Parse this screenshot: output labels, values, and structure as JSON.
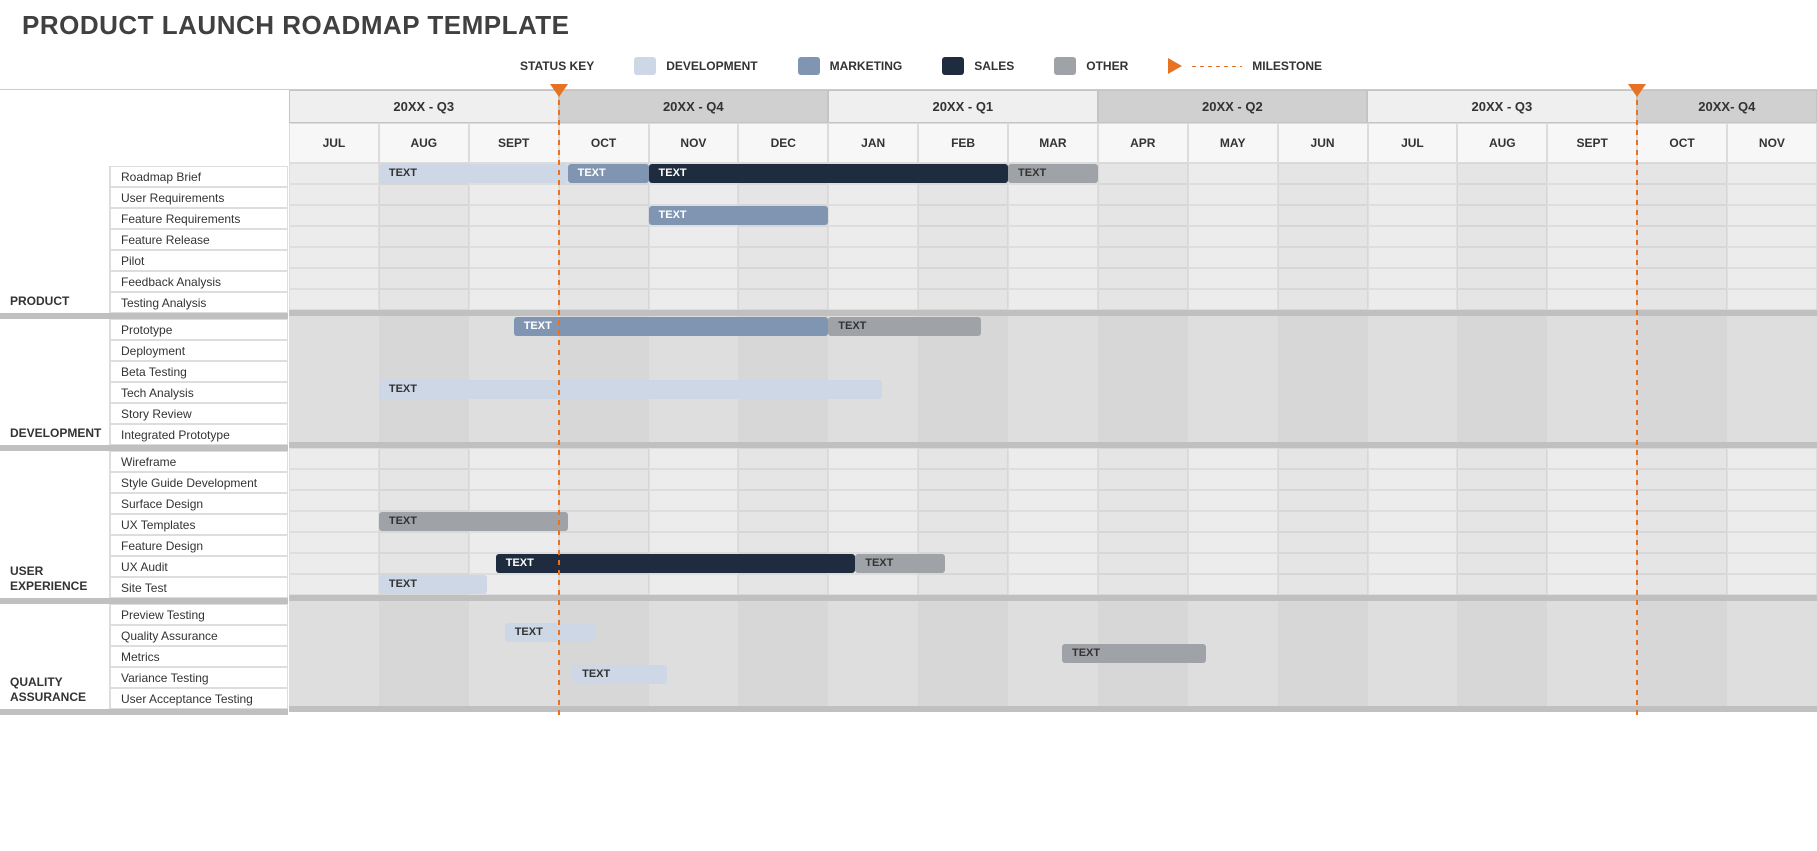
{
  "title": "PRODUCT LAUNCH ROADMAP TEMPLATE",
  "legend": {
    "key_label": "STATUS KEY",
    "development": "DEVELOPMENT",
    "marketing": "MARKETING",
    "sales": "SALES",
    "other": "OTHER",
    "milestone": "MILESTONE"
  },
  "quarters": [
    "20XX - Q3",
    "20XX - Q4",
    "20XX - Q1",
    "20XX - Q2",
    "20XX - Q3",
    "20XX- Q4"
  ],
  "months": [
    "JUL",
    "AUG",
    "SEPT",
    "OCT",
    "NOV",
    "DEC",
    "JAN",
    "FEB",
    "MAR",
    "APR",
    "MAY",
    "JUN",
    "JUL",
    "AUG",
    "SEPT",
    "OCT",
    "NOV"
  ],
  "month_count": 17,
  "milestones": [
    3,
    15
  ],
  "sections": [
    {
      "name": "PRODUCT",
      "tasks": [
        {
          "label": "Roadmap Brief",
          "bars": [
            {
              "type": "dev",
              "start": 1,
              "end": 3.1,
              "text": "TEXT"
            },
            {
              "type": "mkt",
              "start": 3.1,
              "end": 4,
              "text": "TEXT"
            },
            {
              "type": "sales",
              "start": 4,
              "end": 8,
              "text": "TEXT"
            },
            {
              "type": "other",
              "start": 8,
              "end": 9,
              "text": "TEXT"
            }
          ]
        },
        {
          "label": "User Requirements",
          "bars": []
        },
        {
          "label": "Feature Requirements",
          "bars": [
            {
              "type": "mkt",
              "start": 4,
              "end": 6,
              "text": "TEXT"
            }
          ]
        },
        {
          "label": "Feature Release",
          "bars": []
        },
        {
          "label": "Pilot",
          "bars": []
        },
        {
          "label": "Feedback Analysis",
          "bars": []
        },
        {
          "label": "Testing Analysis",
          "bars": []
        }
      ]
    },
    {
      "name": "DEVELOPMENT",
      "tasks": [
        {
          "label": "Prototype",
          "bars": [
            {
              "type": "mkt",
              "start": 2.5,
              "end": 6,
              "text": "TEXT"
            },
            {
              "type": "other",
              "start": 6,
              "end": 7.7,
              "text": "TEXT"
            }
          ]
        },
        {
          "label": "Deployment",
          "bars": []
        },
        {
          "label": "Beta Testing",
          "bars": []
        },
        {
          "label": "Tech Analysis",
          "bars": [
            {
              "type": "dev",
              "start": 1,
              "end": 6.6,
              "text": "TEXT"
            }
          ]
        },
        {
          "label": "Story Review",
          "bars": []
        },
        {
          "label": "Integrated Prototype",
          "bars": []
        }
      ]
    },
    {
      "name": "USER EXPERIENCE",
      "tasks": [
        {
          "label": "Wireframe",
          "bars": []
        },
        {
          "label": "Style Guide Development",
          "bars": []
        },
        {
          "label": "Surface Design",
          "bars": []
        },
        {
          "label": "UX Templates",
          "bars": [
            {
              "type": "other",
              "start": 1,
              "end": 3.1,
              "text": "TEXT"
            }
          ]
        },
        {
          "label": "Feature Design",
          "bars": []
        },
        {
          "label": "UX Audit",
          "bars": [
            {
              "type": "sales",
              "start": 2.3,
              "end": 6.3,
              "text": "TEXT"
            },
            {
              "type": "other",
              "start": 6.3,
              "end": 7.3,
              "text": "TEXT"
            }
          ]
        },
        {
          "label": "Site Test",
          "bars": [
            {
              "type": "dev",
              "start": 1,
              "end": 2.2,
              "text": "TEXT"
            }
          ]
        }
      ]
    },
    {
      "name": "QUALITY ASSURANCE",
      "tasks": [
        {
          "label": "Preview Testing",
          "bars": []
        },
        {
          "label": "Quality Assurance",
          "bars": [
            {
              "type": "dev",
              "start": 2.4,
              "end": 3.4,
              "text": "TEXT"
            }
          ]
        },
        {
          "label": "Metrics",
          "bars": [
            {
              "type": "other",
              "start": 8.6,
              "end": 10.2,
              "text": "TEXT"
            }
          ]
        },
        {
          "label": "Variance Testing",
          "bars": [
            {
              "type": "dev",
              "start": 3.15,
              "end": 4.2,
              "text": "TEXT"
            }
          ]
        },
        {
          "label": "User Acceptance Testing",
          "bars": []
        }
      ]
    }
  ],
  "chart_data": {
    "type": "gantt",
    "title": "PRODUCT LAUNCH ROADMAP TEMPLATE",
    "x_unit": "month_index (0 = JUL year1)",
    "x_labels": [
      "JUL",
      "AUG",
      "SEPT",
      "OCT",
      "NOV",
      "DEC",
      "JAN",
      "FEB",
      "MAR",
      "APR",
      "MAY",
      "JUN",
      "JUL",
      "AUG",
      "SEPT",
      "OCT",
      "NOV"
    ],
    "x_quarters": [
      "20XX-Q3",
      "20XX-Q4",
      "20XX-Q1",
      "20XX-Q2",
      "20XX-Q3",
      "20XX-Q4"
    ],
    "categories": [
      "DEVELOPMENT",
      "MARKETING",
      "SALES",
      "OTHER"
    ],
    "milestones_at": [
      3,
      15
    ],
    "rows": [
      {
        "section": "PRODUCT",
        "task": "Roadmap Brief",
        "segments": [
          {
            "cat": "DEVELOPMENT",
            "start": 1,
            "end": 3.1,
            "label": "TEXT"
          },
          {
            "cat": "MARKETING",
            "start": 3.1,
            "end": 4,
            "label": "TEXT"
          },
          {
            "cat": "SALES",
            "start": 4,
            "end": 8,
            "label": "TEXT"
          },
          {
            "cat": "OTHER",
            "start": 8,
            "end": 9,
            "label": "TEXT"
          }
        ]
      },
      {
        "section": "PRODUCT",
        "task": "User Requirements",
        "segments": []
      },
      {
        "section": "PRODUCT",
        "task": "Feature Requirements",
        "segments": [
          {
            "cat": "MARKETING",
            "start": 4,
            "end": 6,
            "label": "TEXT"
          }
        ]
      },
      {
        "section": "PRODUCT",
        "task": "Feature Release",
        "segments": []
      },
      {
        "section": "PRODUCT",
        "task": "Pilot",
        "segments": []
      },
      {
        "section": "PRODUCT",
        "task": "Feedback Analysis",
        "segments": []
      },
      {
        "section": "PRODUCT",
        "task": "Testing Analysis",
        "segments": []
      },
      {
        "section": "DEVELOPMENT",
        "task": "Prototype",
        "segments": [
          {
            "cat": "MARKETING",
            "start": 2.5,
            "end": 6,
            "label": "TEXT"
          },
          {
            "cat": "OTHER",
            "start": 6,
            "end": 7.7,
            "label": "TEXT"
          }
        ]
      },
      {
        "section": "DEVELOPMENT",
        "task": "Deployment",
        "segments": []
      },
      {
        "section": "DEVELOPMENT",
        "task": "Beta Testing",
        "segments": []
      },
      {
        "section": "DEVELOPMENT",
        "task": "Tech Analysis",
        "segments": [
          {
            "cat": "DEVELOPMENT",
            "start": 1,
            "end": 6.6,
            "label": "TEXT"
          }
        ]
      },
      {
        "section": "DEVELOPMENT",
        "task": "Story Review",
        "segments": []
      },
      {
        "section": "DEVELOPMENT",
        "task": "Integrated Prototype",
        "segments": []
      },
      {
        "section": "USER EXPERIENCE",
        "task": "Wireframe",
        "segments": []
      },
      {
        "section": "USER EXPERIENCE",
        "task": "Style Guide Development",
        "segments": []
      },
      {
        "section": "USER EXPERIENCE",
        "task": "Surface Design",
        "segments": []
      },
      {
        "section": "USER EXPERIENCE",
        "task": "UX Templates",
        "segments": [
          {
            "cat": "OTHER",
            "start": 1,
            "end": 3.1,
            "label": "TEXT"
          }
        ]
      },
      {
        "section": "USER EXPERIENCE",
        "task": "Feature Design",
        "segments": []
      },
      {
        "section": "USER EXPERIENCE",
        "task": "UX Audit",
        "segments": [
          {
            "cat": "SALES",
            "start": 2.3,
            "end": 6.3,
            "label": "TEXT"
          },
          {
            "cat": "OTHER",
            "start": 6.3,
            "end": 7.3,
            "label": "TEXT"
          }
        ]
      },
      {
        "section": "USER EXPERIENCE",
        "task": "Site Test",
        "segments": [
          {
            "cat": "DEVELOPMENT",
            "start": 1,
            "end": 2.2,
            "label": "TEXT"
          }
        ]
      },
      {
        "section": "QUALITY ASSURANCE",
        "task": "Preview Testing",
        "segments": []
      },
      {
        "section": "QUALITY ASSURANCE",
        "task": "Quality Assurance",
        "segments": [
          {
            "cat": "DEVELOPMENT",
            "start": 2.4,
            "end": 3.4,
            "label": "TEXT"
          }
        ]
      },
      {
        "section": "QUALITY ASSURANCE",
        "task": "Metrics",
        "segments": [
          {
            "cat": "OTHER",
            "start": 8.6,
            "end": 10.2,
            "label": "TEXT"
          }
        ]
      },
      {
        "section": "QUALITY ASSURANCE",
        "task": "Variance Testing",
        "segments": [
          {
            "cat": "DEVELOPMENT",
            "start": 3.15,
            "end": 4.2,
            "label": "TEXT"
          }
        ]
      },
      {
        "section": "QUALITY ASSURANCE",
        "task": "User Acceptance Testing",
        "segments": []
      }
    ]
  }
}
